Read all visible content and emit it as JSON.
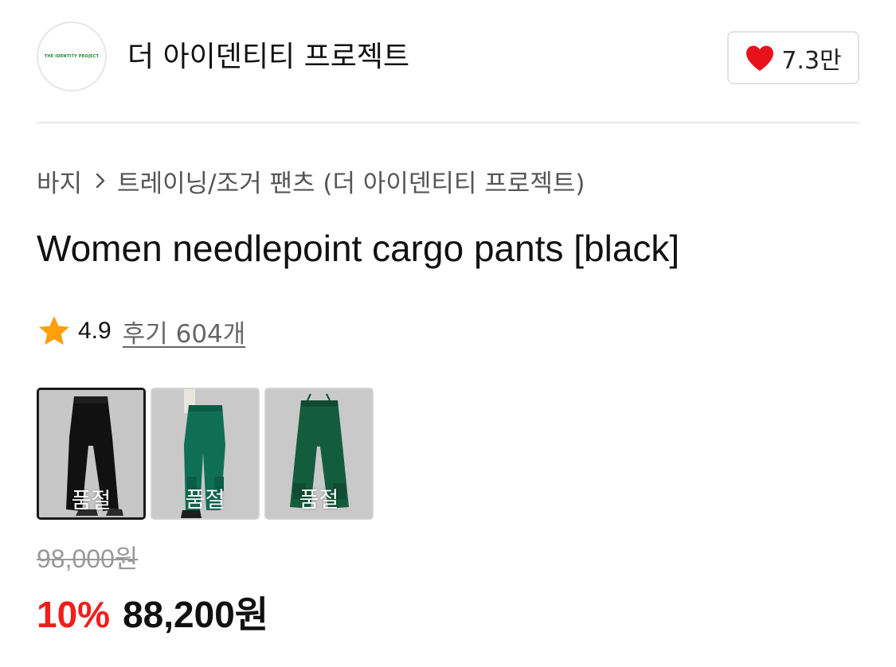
{
  "brand": {
    "logo_text": "THE IDENTITY PROJECT",
    "name": "더 아이덴티티 프로젝트",
    "like_count": "7.3만",
    "heart_color": "#e8121d"
  },
  "breadcrumb": {
    "items": [
      "바지",
      "트레이닝/조거 팬츠 (더 아이덴티티 프로젝트)"
    ]
  },
  "product": {
    "title": "Women needlepoint cargo pants [black]",
    "rating": "4.9",
    "review_link": "후기 604개",
    "star_color": "#ff9f0a"
  },
  "thumbnails": [
    {
      "label": "품절",
      "selected": true,
      "color": "black",
      "icon": "pants-thumbnail-black"
    },
    {
      "label": "품절",
      "selected": false,
      "color": "green",
      "icon": "pants-thumbnail-green-worn"
    },
    {
      "label": "품절",
      "selected": false,
      "color": "dark green",
      "icon": "pants-thumbnail-green-flat"
    }
  ],
  "price": {
    "original": "98,000원",
    "discount": "10%",
    "sale": "88,200원",
    "discount_color": "#f21d1d"
  }
}
